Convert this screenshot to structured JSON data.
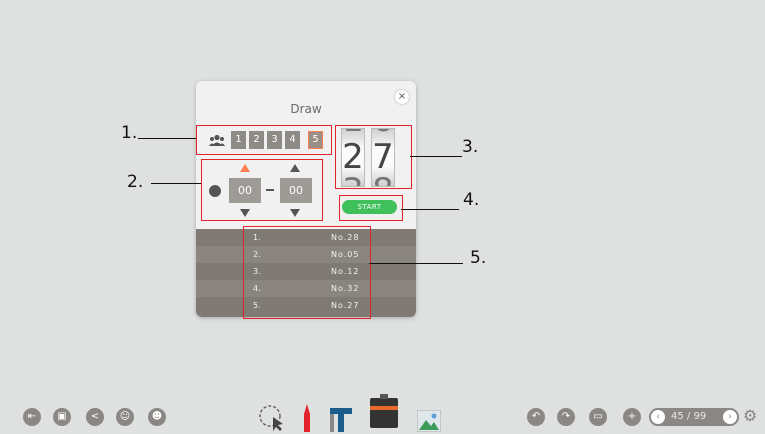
{
  "dialog": {
    "title": "Draw",
    "close_glyph": "×",
    "group_icon": "group-icon",
    "group_numbers": [
      "1",
      "2",
      "3",
      "4",
      "5"
    ],
    "selected_group": "5",
    "range": {
      "from": "00",
      "to": "00",
      "icon": "range-icon"
    },
    "drum_digits": [
      "2",
      "7"
    ],
    "start_label": "START",
    "results": [
      {
        "idx": "1.",
        "val": "No.28"
      },
      {
        "idx": "2.",
        "val": "No.05"
      },
      {
        "idx": "3.",
        "val": "No.12"
      },
      {
        "idx": "4.",
        "val": "No.32"
      },
      {
        "idx": "5.",
        "val": "No.27"
      }
    ]
  },
  "annotations": [
    "1.",
    "2.",
    "3.",
    "4.",
    "5."
  ],
  "toolbar": {
    "left_icons": [
      "exit-icon",
      "save-icon",
      "share-icon",
      "add-user-icon",
      "user-settings-icon"
    ],
    "center_tools": [
      "select-tool-icon",
      "pen-tool-icon",
      "text-tool-icon",
      "toolbox-icon",
      "image-tool-icon"
    ],
    "right_icons": [
      "undo-icon",
      "redo-icon",
      "screen-icon",
      "add-page-icon"
    ],
    "page": "45 / 99",
    "settings_icon": "gear-icon"
  },
  "colors": {
    "background": "#dee1e0",
    "accent_orange": "#ff7f50",
    "start_green": "#3fc05b",
    "annotation_red": "#e3232c"
  }
}
